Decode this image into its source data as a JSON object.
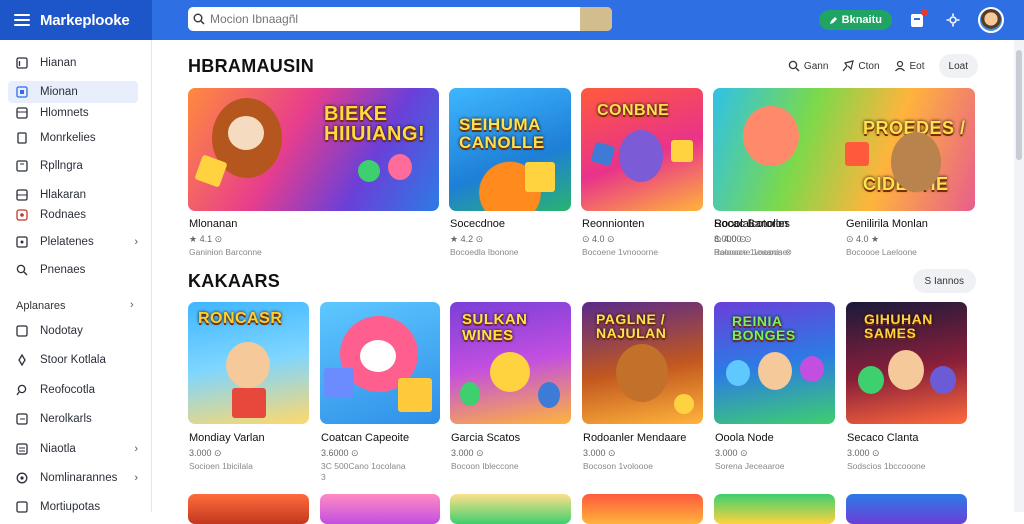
{
  "app": {
    "title": "Markeplooke",
    "search_placeholder": "Mocion Ibnaagñl",
    "cta_label": "Bknaitu"
  },
  "sidebar": {
    "items": [
      {
        "label": "Hianan",
        "icon": "library-icon"
      },
      {
        "label": "Mionan",
        "icon": "home-icon"
      },
      {
        "label": "Hlomnets",
        "icon": "grid-icon"
      },
      {
        "label": "Monrkelies",
        "icon": "file-icon"
      },
      {
        "label": "Rpllngra",
        "icon": "app-icon"
      },
      {
        "label": "Hlakaran",
        "icon": "window-icon"
      },
      {
        "label": "Rodnaes",
        "icon": "tag-icon"
      },
      {
        "label": "Plelatenes",
        "icon": "image-icon"
      },
      {
        "label": "Pnenaes",
        "icon": "search-icon"
      }
    ],
    "section": {
      "label": "Aplanares"
    },
    "section_items": [
      {
        "label": "Nodotay",
        "icon": "window-icon"
      },
      {
        "label": "Stoor Kotlala",
        "icon": "pin-icon"
      },
      {
        "label": "Reofocotla",
        "icon": "search-icon"
      },
      {
        "label": "Nerolkarls",
        "icon": "window-icon"
      },
      {
        "label": "Niaotla",
        "icon": "list-icon"
      },
      {
        "label": "Nomlinarannes",
        "icon": "globe-icon"
      },
      {
        "label": "Mortiupotas",
        "icon": "window-icon"
      }
    ]
  },
  "main": {
    "section1": {
      "title": "HBRAMAUSIN"
    },
    "toolbar": {
      "sort": "Gann",
      "filter": "Cton",
      "view": "Eot",
      "more": "Loat"
    },
    "row1": [
      {
        "title_art": "BIEKE HIIUIANG!",
        "name": "Mlonanan",
        "meta": "★ 4.1 ⊙",
        "sub": "Ganinion Barconne"
      },
      {
        "title_art": "SEIHUMA CANOLLE",
        "name": "Socecdnoe",
        "meta": "★ 4.2 ⊙",
        "sub": "Bocoedla Ibonone"
      },
      {
        "title_art": "CONBNE",
        "name": "Reonnionten",
        "meta": "⊙ 4.0 ⊙",
        "sub": "Bocoene 1vnooorne"
      },
      {
        "title_art": "PROEDES / CIDEOHE",
        "name": "Socac Banolon",
        "meta": "8.0000 ⊙",
        "sub": "Baoooce 1vnooone"
      },
      {
        "title_art": "",
        "name": "Rooolalcotorles",
        "meta": "⊙ 4.0 ⊙",
        "sub": "Rolooone 1oaanis ⊗"
      },
      {
        "title_art": "",
        "name": "Genilirila Monlan",
        "meta": "⊙ 4.0 ★",
        "sub": "Bocoooe Laeloone"
      }
    ],
    "section2": {
      "title": "KAKAARS",
      "see_all": "S Iannos"
    },
    "row2": [
      {
        "title_art": "RONCASR",
        "name": "Mondiay Varlan",
        "meta": "3.000 ⊙",
        "sub": "Socioen 1bicilala"
      },
      {
        "title_art": "",
        "name": "Coatcan Capeoite",
        "meta": "3.6000 ⊙",
        "sub": "3C 500Cano 1ocolana",
        "sub2": "3"
      },
      {
        "title_art": "SULKAN WINES",
        "name": "Garcia Scatos",
        "meta": "3.000 ⊙",
        "sub": "Bocoon Ibleccone"
      },
      {
        "title_art": "PAGLNE / NAJULAN",
        "name": "Rodoanler Mendaare",
        "meta": "3.000 ⊙",
        "sub": "Bocoson 1voloooe"
      },
      {
        "title_art": "REINIA BONGES",
        "name": "Ooola Node",
        "meta": "3.000 ⊙",
        "sub": "Sorena Jeceaaroe"
      },
      {
        "title_art": "GIHUHAN SAMES",
        "name": "Secaco Clanta",
        "meta": "3.000 ⊙",
        "sub": "Sodscios 1bccooone"
      }
    ]
  }
}
